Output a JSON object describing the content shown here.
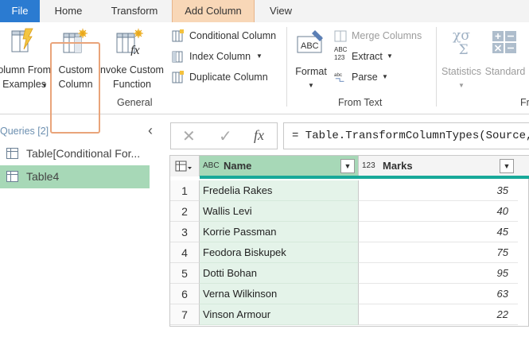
{
  "tabs": {
    "file": "File",
    "home": "Home",
    "transform": "Transform",
    "add_column": "Add Column",
    "view": "View"
  },
  "ribbon": {
    "column_from_examples": [
      "olumn From",
      "Examples"
    ],
    "custom_column": [
      "Custom",
      "Column"
    ],
    "invoke_custom_function": [
      "nvoke Custom",
      "Function"
    ],
    "conditional_column": "Conditional Column",
    "index_column": "Index Column",
    "duplicate_column": "Duplicate Column",
    "general_group": "General",
    "format": "Format",
    "merge_columns": "Merge Columns",
    "extract": "Extract",
    "parse": "Parse",
    "abc_badge": "ABC",
    "abc123_badge": [
      "ABC",
      "123"
    ],
    "from_text_group": "From Text",
    "statistics": "Statistics",
    "standard": "Standard",
    "next_group_partial": "Fr"
  },
  "queries": {
    "header": "Queries [2]",
    "items": [
      {
        "label": "Table[Conditional For..."
      },
      {
        "label": "Table4"
      }
    ]
  },
  "formula": {
    "text": "= Table.TransformColumnTypes(Source,"
  },
  "grid": {
    "columns": [
      {
        "type_badge": "ABC",
        "name": "Name"
      },
      {
        "type_badge": "123",
        "name": "Marks"
      }
    ],
    "rows": [
      {
        "idx": "1",
        "name": "Fredelia Rakes",
        "marks": "35"
      },
      {
        "idx": "2",
        "name": "Wallis Levi",
        "marks": "40"
      },
      {
        "idx": "3",
        "name": "Korrie Passman",
        "marks": "45"
      },
      {
        "idx": "4",
        "name": "Feodora Biskupek",
        "marks": "75"
      },
      {
        "idx": "5",
        "name": "Dotti Bohan",
        "marks": "95"
      },
      {
        "idx": "6",
        "name": "Verna Wilkinson",
        "marks": "63"
      },
      {
        "idx": "7",
        "name": "Vinson Armour",
        "marks": "22"
      }
    ]
  }
}
